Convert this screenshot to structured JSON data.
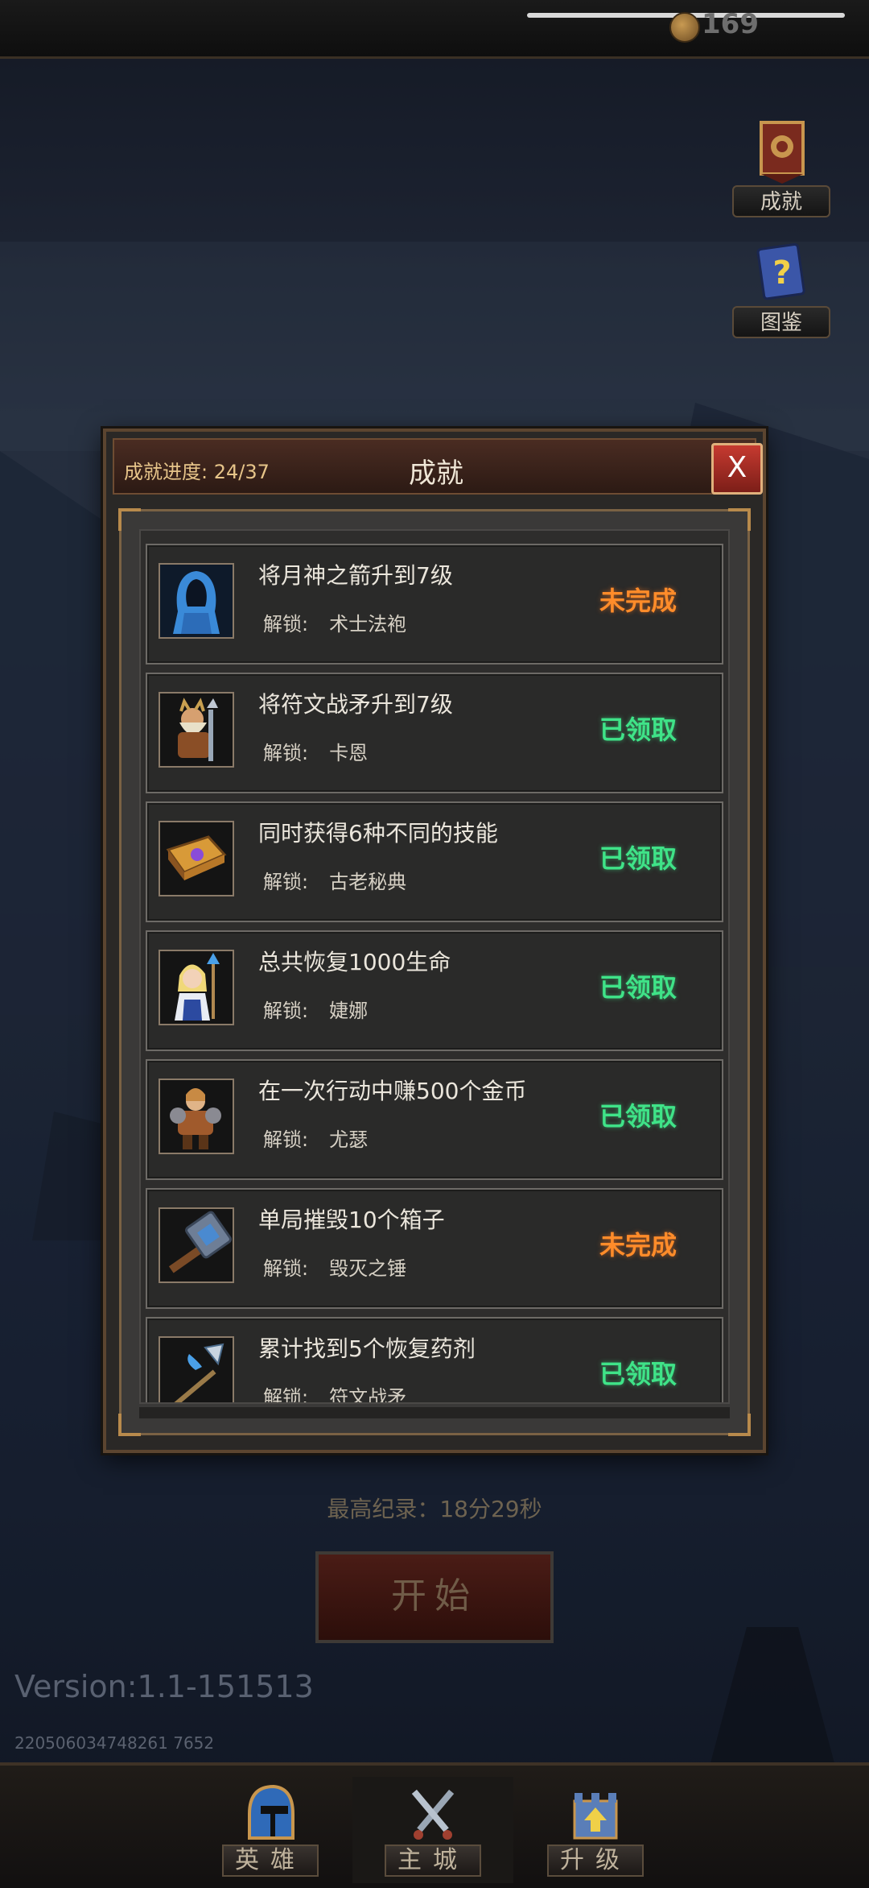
{
  "header": {
    "coins": "169"
  },
  "side_menu": [
    {
      "label": "成就",
      "icon": "trophy-banner-icon"
    },
    {
      "label": "图鉴",
      "icon": "question-book-icon"
    }
  ],
  "dialog": {
    "progress_label": "成就进度: 24/37",
    "title": "成就",
    "close_label": "X",
    "unlock_prefix": "解锁:",
    "achievements": [
      {
        "title": "将月神之箭升到7级",
        "reward": "术士法袍",
        "status": "未完成",
        "state": "incomplete",
        "icon": "blue-robe-icon"
      },
      {
        "title": "将符文战矛升到7级",
        "reward": "卡恩",
        "status": "已领取",
        "state": "claimed",
        "icon": "dwarf-hero-icon"
      },
      {
        "title": "同时获得6种不同的技能",
        "reward": "古老秘典",
        "status": "已领取",
        "state": "claimed",
        "icon": "spellbook-icon"
      },
      {
        "title": "总共恢复1000生命",
        "reward": "婕娜",
        "status": "已领取",
        "state": "claimed",
        "icon": "mage-girl-icon"
      },
      {
        "title": "在一次行动中赚500个金币",
        "reward": "尤瑟",
        "status": "已领取",
        "state": "claimed",
        "icon": "armored-warrior-icon"
      },
      {
        "title": "单局摧毁10个箱子",
        "reward": "毁灭之锤",
        "status": "未完成",
        "state": "incomplete",
        "icon": "hammer-icon"
      },
      {
        "title": "累计找到5个恢复药剂",
        "reward": "符文战矛",
        "status": "已领取",
        "state": "claimed",
        "icon": "spear-icon"
      }
    ]
  },
  "best_record": "最高纪录：18分29秒",
  "start_label": "开始",
  "version": "Version:1.1-151513",
  "build_id": "220506034748261 7652",
  "bottom_nav": [
    {
      "label": "英雄",
      "icon": "knight-helmet-icon"
    },
    {
      "label": "主城",
      "icon": "crossed-swords-icon"
    },
    {
      "label": "升级",
      "icon": "castle-upgrade-icon"
    }
  ],
  "colors": {
    "incomplete": "#ff8c2a",
    "claimed": "#3fe388",
    "accent_gold": "#b88a4c"
  }
}
